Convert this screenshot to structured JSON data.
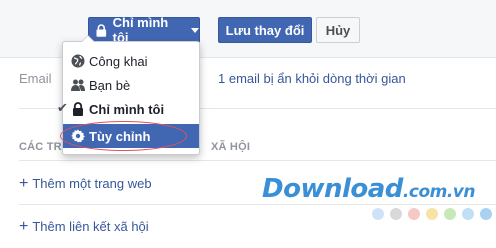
{
  "toolbar": {
    "privacy_label": "Chỉ mình tôi",
    "save_label": "Lưu thay đổi",
    "cancel_label": "Hủy"
  },
  "privacy_menu": {
    "items": [
      {
        "label": "Công khai",
        "icon": "globe-icon"
      },
      {
        "label": "Bạn bè",
        "icon": "friends-icon"
      },
      {
        "label": "Chỉ mình tôi",
        "icon": "lock-icon",
        "checked": true
      },
      {
        "label": "Tùy chỉnh",
        "icon": "gear-icon",
        "highlighted": true
      }
    ]
  },
  "email_row": {
    "label": "Email",
    "value": "1 email bị ẩn khỏi dòng thời gian"
  },
  "social_section": {
    "title_left": "CÁC TR",
    "title_right": "XÃ HỘI",
    "add_website": "Thêm một trang web",
    "add_social_link": "Thêm liên kết xã hội"
  },
  "watermark": {
    "brand": "Download",
    "suffix": ".com.vn",
    "dot_colors": [
      "#cfe3f6",
      "#d9d9d9",
      "#f6c9c4",
      "#f8e3a6",
      "#c7e8b7",
      "#bfe0f5",
      "#a9d1f2"
    ]
  },
  "colors": {
    "accent": "#4267b2",
    "link": "#365899",
    "highlight_oval": "#e0525f"
  }
}
